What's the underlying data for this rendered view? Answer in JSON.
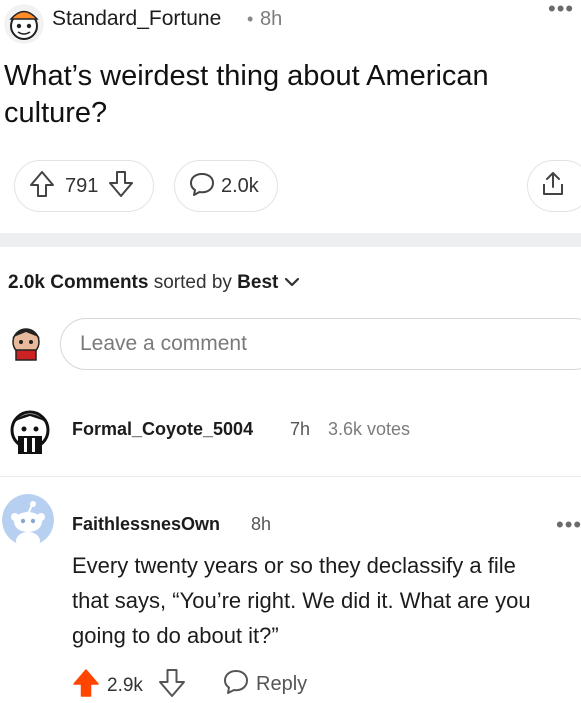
{
  "post": {
    "author": "Standard_Fortune",
    "time": "8h",
    "title": "What’s weirdest thing about American culture?",
    "upvotes": "791",
    "comments": "2.0k"
  },
  "comments_header": {
    "count": "2.0k Comments",
    "sorted_by": "sorted by",
    "sort": "Best"
  },
  "comment_input": {
    "placeholder": "Leave a comment"
  },
  "poll_comment": {
    "user": "Formal_Coyote_5004",
    "time": "7h",
    "votes": "3.6k votes"
  },
  "top_comment": {
    "user": "FaithlessnesOwn",
    "time": "8h",
    "lines": [
      "Every twenty years or so they declassify a file",
      "that says, “You’re right. We did it. What are you",
      "going to do about it?”"
    ],
    "score": "2.9k",
    "reply": "Reply"
  },
  "colors": {
    "upvote_active": "#ff4500",
    "snoo_bg": "#b7cff0"
  }
}
